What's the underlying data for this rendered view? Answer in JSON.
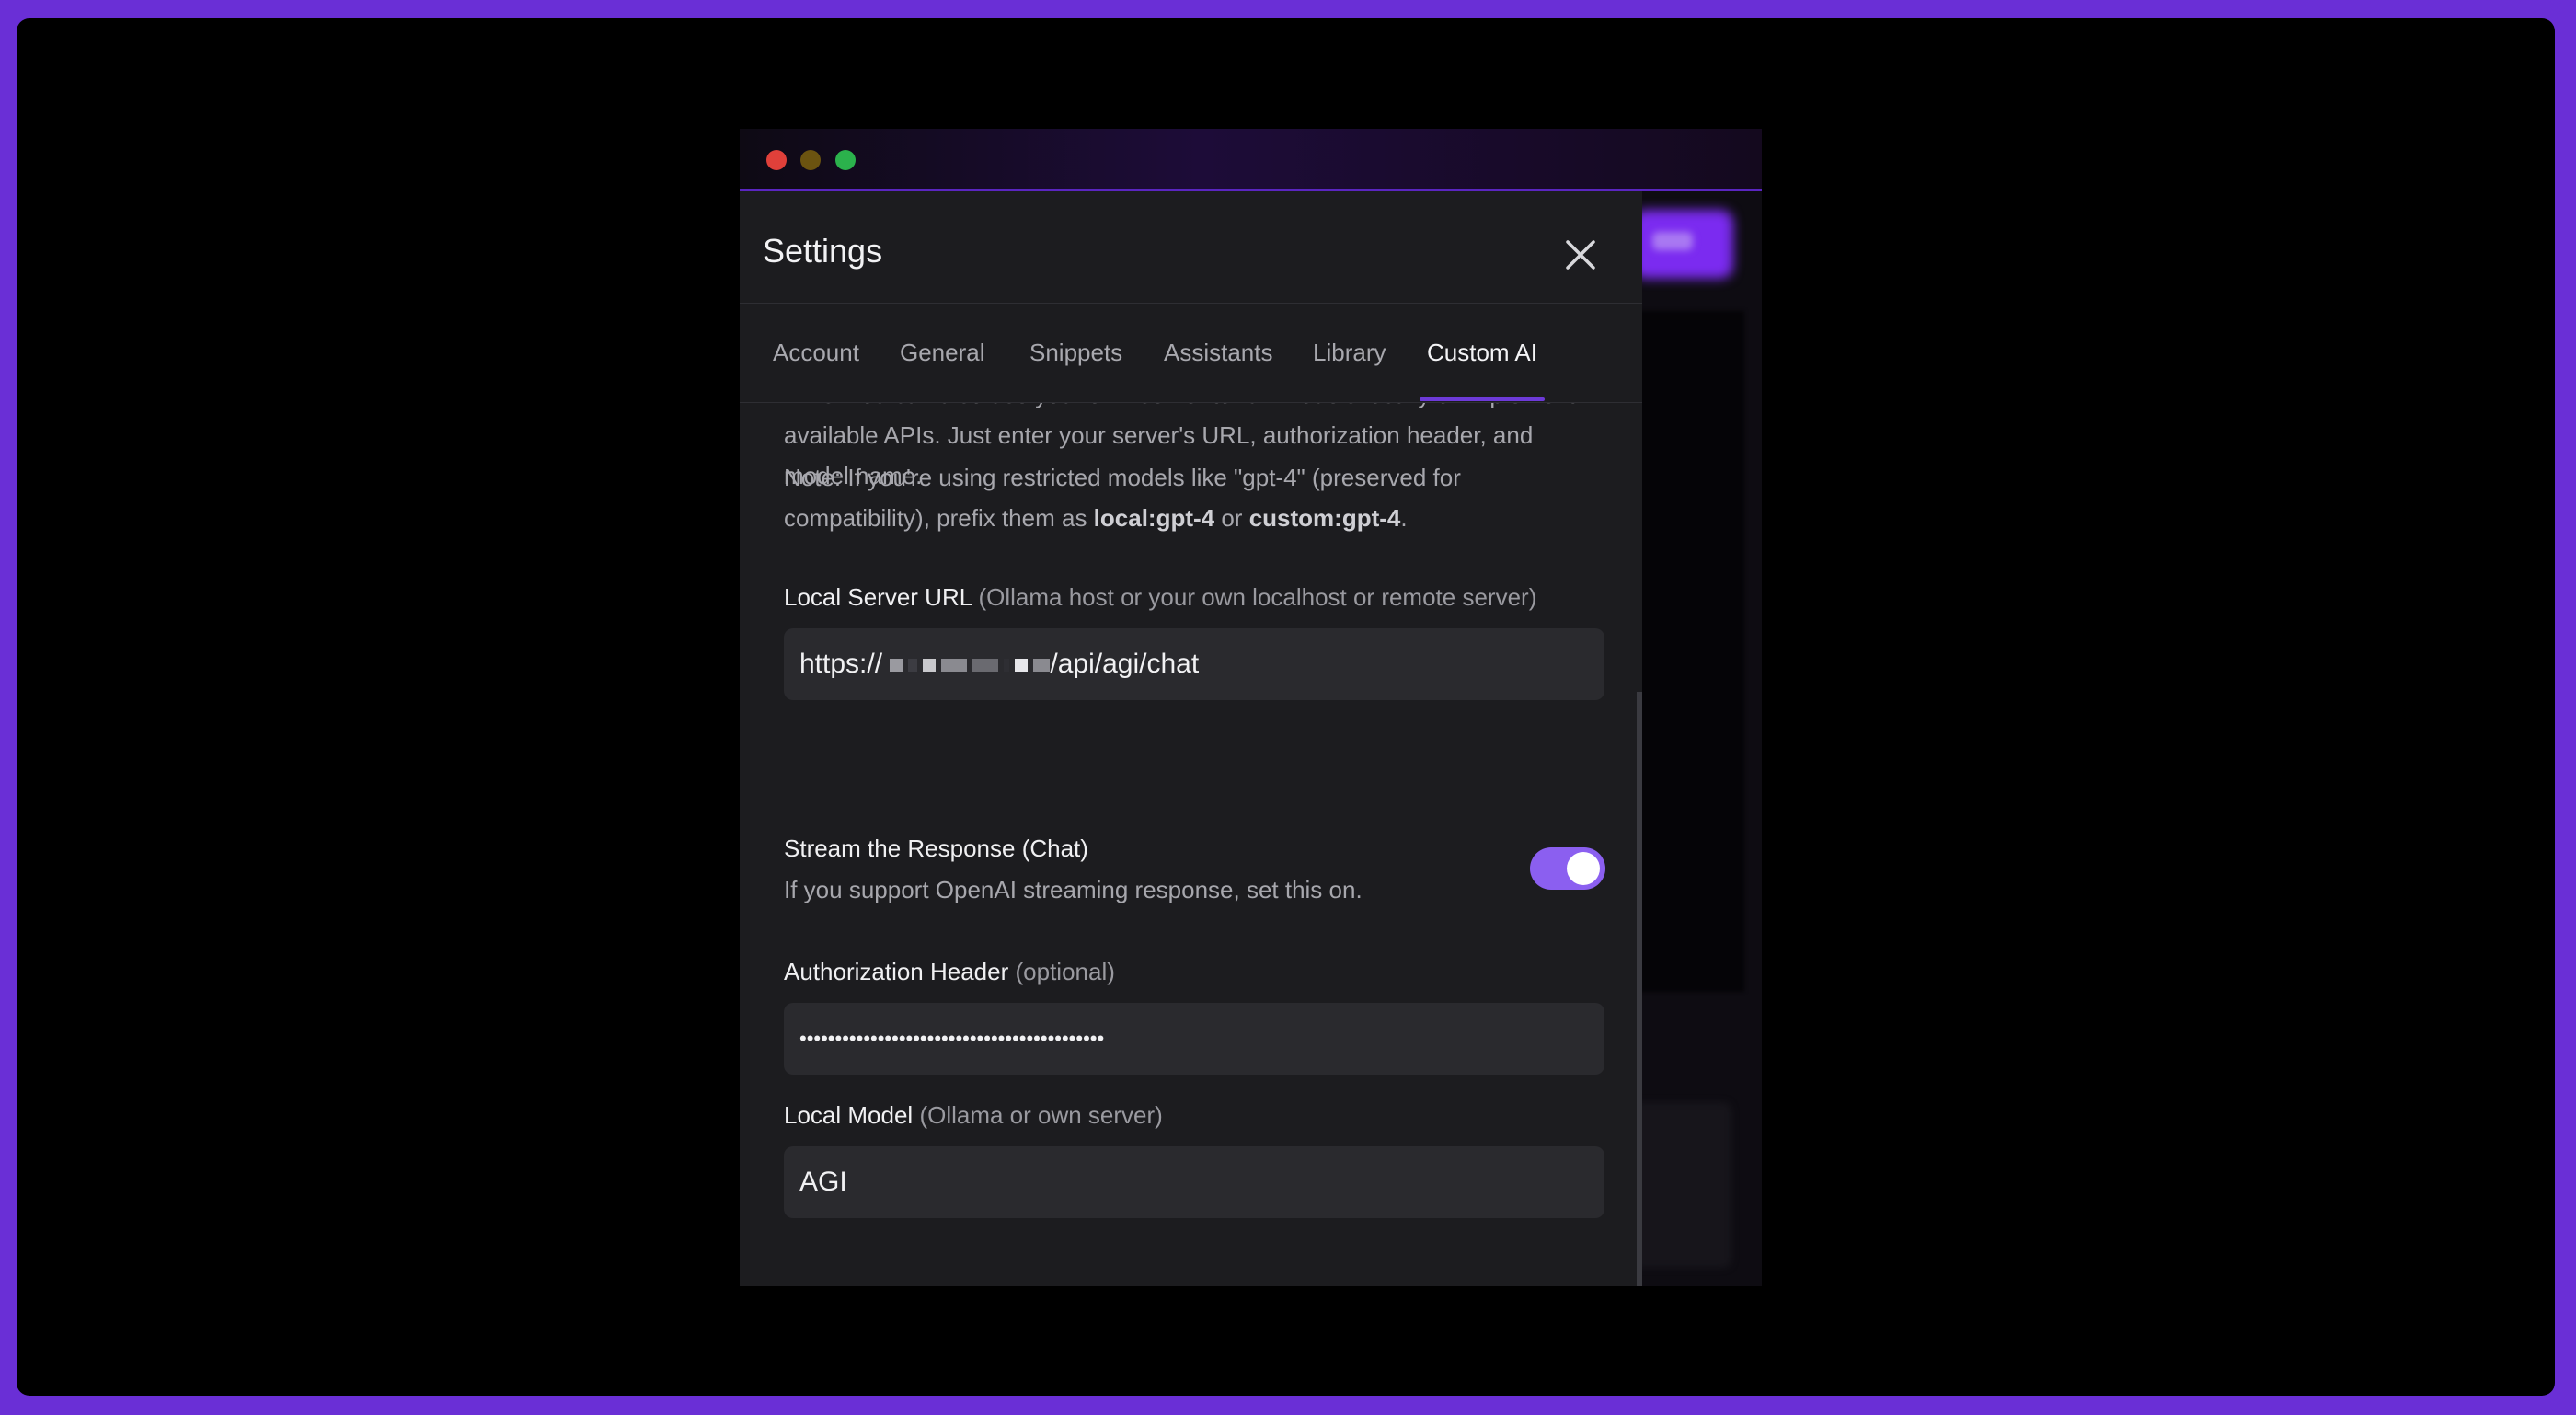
{
  "dialog": {
    "title": "Settings",
    "close_icon": "close-icon"
  },
  "tabs": [
    {
      "label": "Account",
      "active": false
    },
    {
      "label": "General",
      "active": false
    },
    {
      "label": "Snippets",
      "active": false
    },
    {
      "label": "Assistants",
      "active": false
    },
    {
      "label": "Library",
      "active": false
    },
    {
      "label": "Custom AI",
      "active": true
    }
  ],
  "custom_ai": {
    "intro_text": "APIs. You can also use your own server to run models locally or implement available APIs. Just enter your server's URL, authorization header, and model name.",
    "note_prefix": "Note: If you're using restricted models like \"gpt-4\" (preserved for compatibility), prefix them as ",
    "note_local": "local:gpt-4",
    "note_or": " or ",
    "note_custom": "custom:gpt-4",
    "note_end": ".",
    "server_url": {
      "label": "Local Server URL",
      "hint": "(Ollama host or your own localhost or remote server)",
      "value_prefix": "https://",
      "value_suffix": "/api/agi/chat"
    },
    "stream": {
      "title": "Stream the Response (Chat)",
      "description": "If you support OpenAI streaming response, set this on.",
      "enabled": true
    },
    "auth_header": {
      "label": "Authorization Header",
      "hint": "(optional)",
      "value": "•••••••••••••••••••••••••••••••••••••••••••"
    },
    "local_model": {
      "label": "Local Model",
      "hint": "(Ollama or own server)",
      "value": "AGI"
    }
  },
  "colors": {
    "accent": "#6d3ad8",
    "toggle_on": "#8b5ff0",
    "frame": "#6a2fd6"
  }
}
